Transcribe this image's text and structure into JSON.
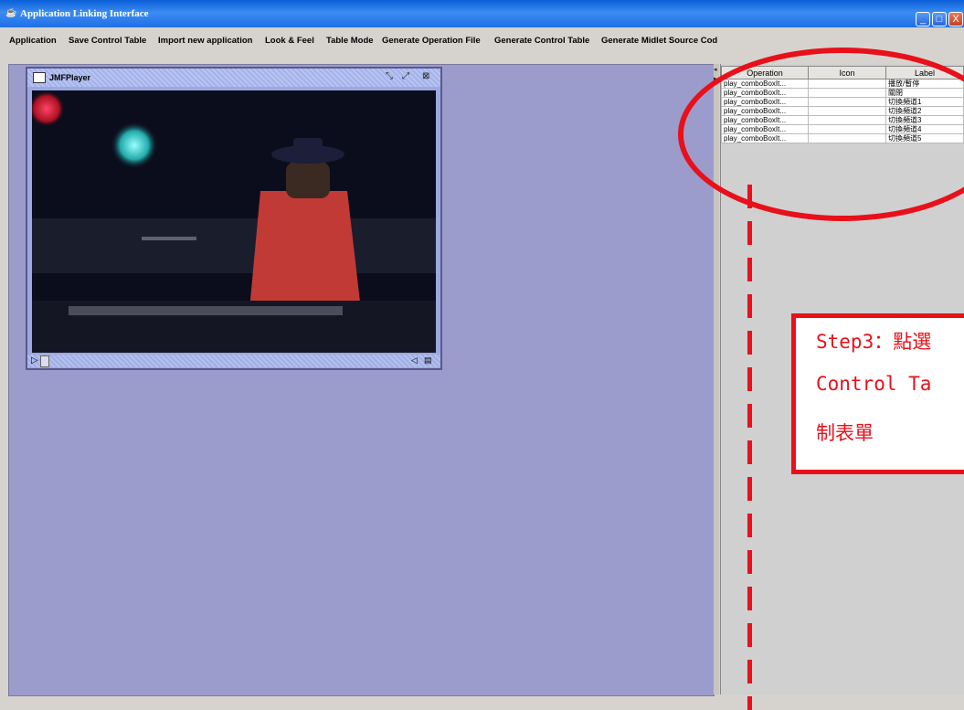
{
  "window": {
    "title": "Application Linking Interface",
    "buttons": {
      "minimize": "_",
      "maximize": "□",
      "close": "X"
    }
  },
  "menu": [
    "Application",
    "Save Control Table",
    "Import new application",
    "Look & Feel",
    "Table Mode",
    "Generate Operation File",
    "Generate Control Table",
    "Generate Midlet Source Cod"
  ],
  "internal_frame": {
    "title": "JMFPlayer",
    "controls": [
      "restore-icon",
      "maximize-icon",
      "close-icon"
    ]
  },
  "control_table": {
    "headers": [
      "Operation",
      "Icon",
      "Label"
    ],
    "rows": [
      [
        "play_comboBoxIt...",
        "",
        "播放/暫停"
      ],
      [
        "play_comboBoxIt...",
        "",
        "關閉"
      ],
      [
        "play_comboBoxIt...",
        "",
        "切換頻道1"
      ],
      [
        "play_comboBoxIt...",
        "",
        "切換頻道2"
      ],
      [
        "play_comboBoxIt...",
        "",
        "切換頻道3"
      ],
      [
        "play_comboBoxIt...",
        "",
        "切換頻道4"
      ],
      [
        "play_comboBoxIt...",
        "",
        "切換頻道5"
      ]
    ]
  },
  "annotation": {
    "line1": "Step3：點選",
    "line2": "Control Ta",
    "line3": "制表單",
    "color": "#e8101a"
  },
  "colors": {
    "desktop": "#9c9ccc",
    "titlebar": "#1f6fe6"
  }
}
